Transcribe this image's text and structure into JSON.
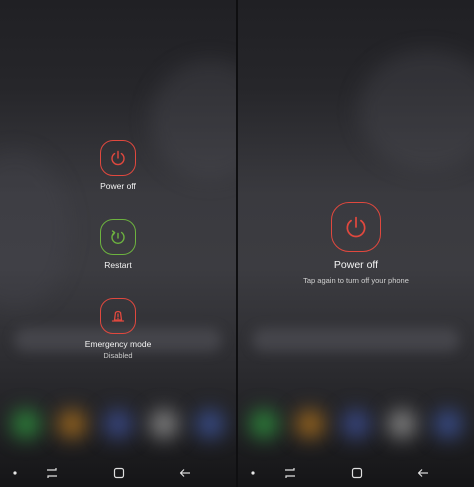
{
  "left_screen": {
    "options": [
      {
        "label": "Power off",
        "sublabel": "",
        "icon": "power-icon",
        "color": "#e0483e"
      },
      {
        "label": "Restart",
        "sublabel": "",
        "icon": "restart-icon",
        "color": "#6db33f"
      },
      {
        "label": "Emergency mode",
        "sublabel": "Disabled",
        "icon": "emergency-beacon-icon",
        "color": "#e0483e"
      }
    ]
  },
  "right_screen": {
    "title": "Power off",
    "hint": "Tap again to turn off your phone",
    "icon": "power-icon",
    "color": "#e0483e"
  },
  "navbar": {
    "buttons": [
      "dot-indicator-icon",
      "recents-icon",
      "home-icon",
      "back-icon"
    ]
  },
  "colors": {
    "accent_red": "#e0483e",
    "accent_green": "#6db33f",
    "text": "#f2f2f2"
  }
}
